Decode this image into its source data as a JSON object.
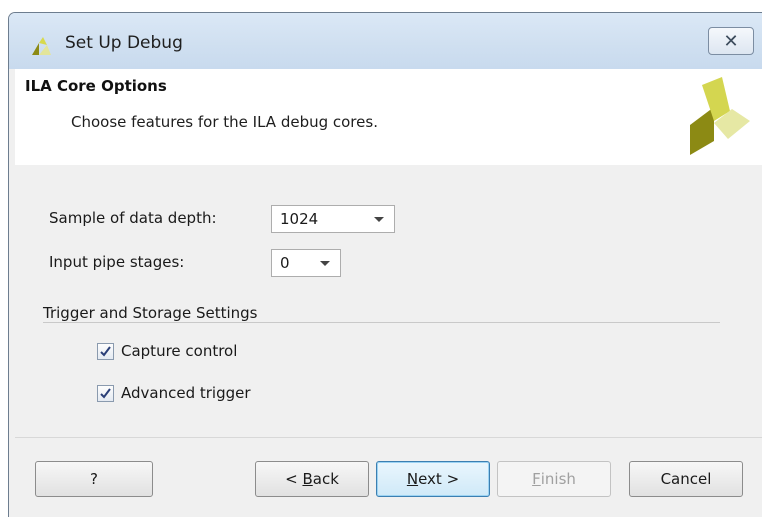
{
  "window": {
    "title": "Set Up Debug",
    "close_glyph": "✕"
  },
  "header": {
    "title": "ILA Core Options",
    "description": "Choose features for the ILA debug cores."
  },
  "fields": {
    "sample_depth": {
      "label": "Sample of data depth:",
      "value": "1024"
    },
    "input_pipe": {
      "label": "Input pipe stages:",
      "value": "0"
    }
  },
  "section": {
    "title": "Trigger and Storage Settings"
  },
  "checkboxes": [
    {
      "label": "Capture control",
      "checked": true
    },
    {
      "label": "Advanced trigger",
      "checked": true
    }
  ],
  "buttons": {
    "help": "?",
    "back": {
      "prefix": "< ",
      "mnemonic": "B",
      "rest": "ack"
    },
    "next": {
      "mnemonic": "N",
      "rest": "ext >"
    },
    "finish": {
      "mnemonic": "F",
      "rest": "inish"
    },
    "cancel": "Cancel"
  },
  "colors": {
    "accent_blue": "#3c7fb1",
    "logo_olive": "#8c8a14",
    "logo_light": "#e3e59a"
  },
  "icons": [
    "xilinx-logo-icon",
    "close-icon",
    "chevron-down-icon",
    "checkmark-icon"
  ]
}
